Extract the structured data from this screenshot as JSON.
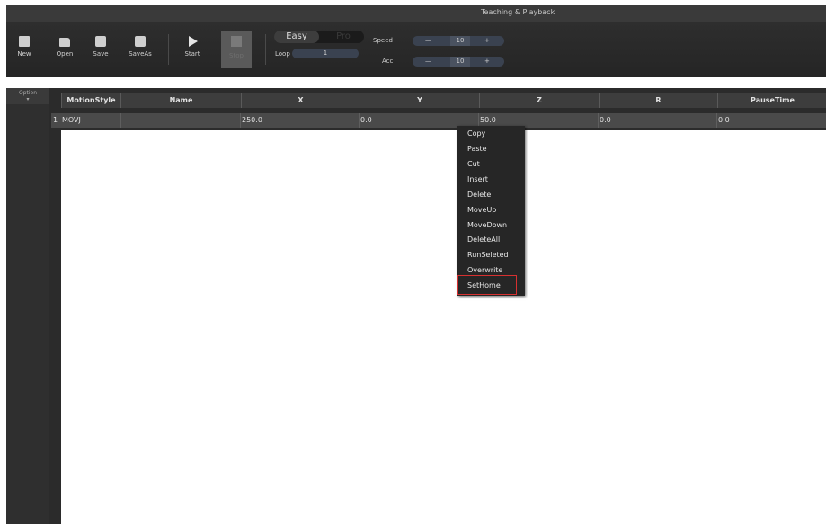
{
  "window": {
    "title": "Teaching & Playback"
  },
  "toolbar": {
    "new_label": "New",
    "open_label": "Open",
    "save_label": "Save",
    "saveas_label": "SaveAs",
    "start_label": "Start",
    "stop_label": "Stop",
    "mode_easy": "Easy",
    "mode_pro": "Pro",
    "loop_label": "Loop",
    "loop_value": "1",
    "speed_label": "Speed",
    "speed_minus": "—",
    "speed_value": "10",
    "speed_plus": "+",
    "acc_label": "Acc",
    "acc_minus": "—",
    "acc_value": "10",
    "acc_plus": "+"
  },
  "sidebar": {
    "header": "Option"
  },
  "table": {
    "columns": [
      "MotionStyle",
      "Name",
      "X",
      "Y",
      "Z",
      "R",
      "PauseTime"
    ],
    "rows": [
      {
        "num": "1",
        "motion": "MOVJ",
        "name": "",
        "x": "250.0",
        "y": "0.0",
        "z": "50.0",
        "r": "0.0",
        "pause": "0.0"
      }
    ]
  },
  "context_menu": {
    "items": [
      "Copy",
      "Paste",
      "Cut",
      "Insert",
      "Delete",
      "MoveUp",
      "MoveDown",
      "DeleteAll",
      "RunSeleted",
      "Overwrite",
      "SetHome"
    ],
    "highlighted": "SetHome",
    "highlight_color": "#d63030"
  },
  "colors": {
    "toolbar_bg": "#2e2e2e",
    "grid_bg": "#2b2b2b",
    "row_bg": "#4a4a4a",
    "menu_bg": "#262626"
  }
}
